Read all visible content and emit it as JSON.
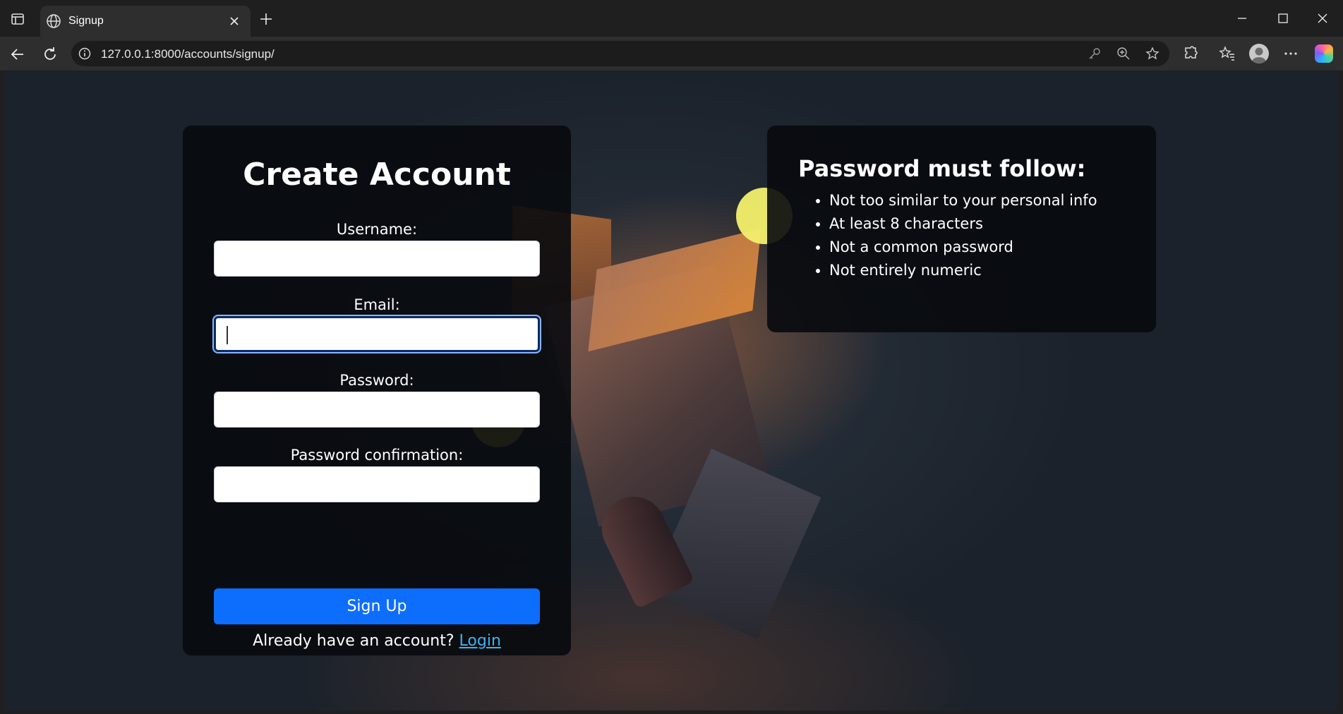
{
  "browser": {
    "tab_title": "Signup",
    "url": "127.0.0.1:8000/accounts/signup/"
  },
  "signup": {
    "heading": "Create Account",
    "fields": [
      {
        "label": "Username:",
        "value": ""
      },
      {
        "label": "Email:",
        "value": ""
      },
      {
        "label": "Password:",
        "value": ""
      },
      {
        "label": "Password confirmation:",
        "value": ""
      }
    ],
    "submit_label": "Sign Up",
    "login_prompt": "Already have an account?",
    "login_link": "Login"
  },
  "rules": {
    "heading": "Password must follow:",
    "items": [
      "Not too similar to your personal info",
      "At least 8 characters",
      "Not a common password",
      "Not entirely numeric"
    ]
  },
  "colors": {
    "primary_button": "#0d6efd",
    "link": "#3db3f1",
    "card_bg": "#080a0e"
  }
}
